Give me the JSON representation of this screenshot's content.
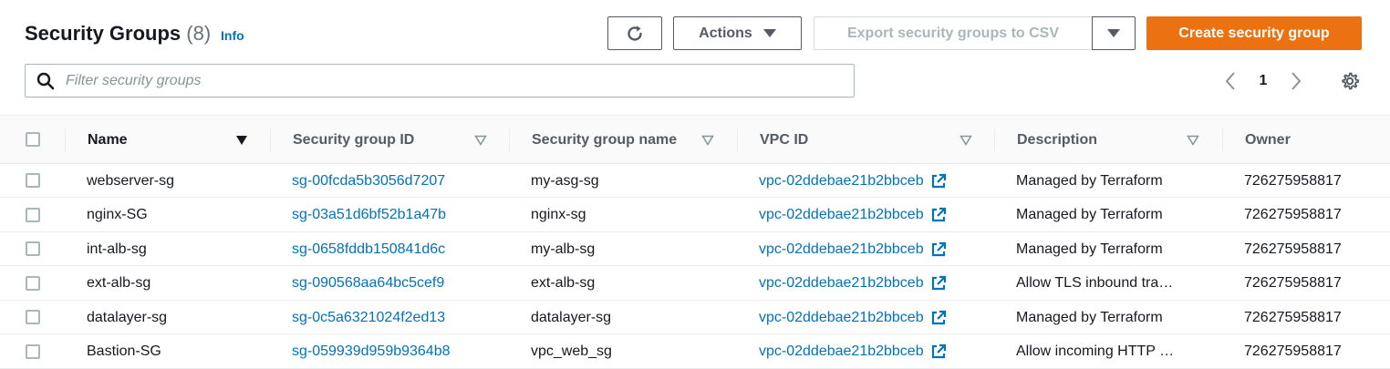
{
  "header": {
    "title": "Security Groups",
    "count": "(8)",
    "info_label": "Info"
  },
  "toolbar": {
    "actions_label": "Actions",
    "export_label": "Export security groups to CSV",
    "create_label": "Create security group"
  },
  "search": {
    "placeholder": "Filter security groups",
    "value": ""
  },
  "pagination": {
    "current_page": "1"
  },
  "table": {
    "columns": [
      "Name",
      "Security group ID",
      "Security group name",
      "VPC ID",
      "Description",
      "Owner"
    ],
    "rows": [
      {
        "name": "webserver-sg",
        "sg_id": "sg-00fcda5b3056d7207",
        "sg_name": "my-asg-sg",
        "vpc_id": "vpc-02ddebae21b2bbceb",
        "description": "Managed by Terraform",
        "owner": "726275958817"
      },
      {
        "name": "nginx-SG",
        "sg_id": "sg-03a51d6bf52b1a47b",
        "sg_name": "nginx-sg",
        "vpc_id": "vpc-02ddebae21b2bbceb",
        "description": "Managed by Terraform",
        "owner": "726275958817"
      },
      {
        "name": "int-alb-sg",
        "sg_id": "sg-0658fddb150841d6c",
        "sg_name": "my-alb-sg",
        "vpc_id": "vpc-02ddebae21b2bbceb",
        "description": "Managed by Terraform",
        "owner": "726275958817"
      },
      {
        "name": "ext-alb-sg",
        "sg_id": "sg-090568aa64bc5cef9",
        "sg_name": "ext-alb-sg",
        "vpc_id": "vpc-02ddebae21b2bbceb",
        "description": "Allow TLS inbound tra…",
        "owner": "726275958817"
      },
      {
        "name": "datalayer-sg",
        "sg_id": "sg-0c5a6321024f2ed13",
        "sg_name": "datalayer-sg",
        "vpc_id": "vpc-02ddebae21b2bbceb",
        "description": "Managed by Terraform",
        "owner": "726275958817"
      },
      {
        "name": "Bastion-SG",
        "sg_id": "sg-059939d959b9364b8",
        "sg_name": "vpc_web_sg",
        "vpc_id": "vpc-02ddebae21b2bbceb",
        "description": "Allow incoming HTTP …",
        "owner": "726275958817"
      }
    ]
  },
  "colors": {
    "primary_button": "#ec7211",
    "link": "#0073bb",
    "header_bg": "#fafafa"
  },
  "icons": {
    "refresh": "refresh-icon",
    "search": "search-icon",
    "settings": "gear-icon",
    "external_link": "external-link-icon",
    "sort": "sort-triangle-icon"
  }
}
